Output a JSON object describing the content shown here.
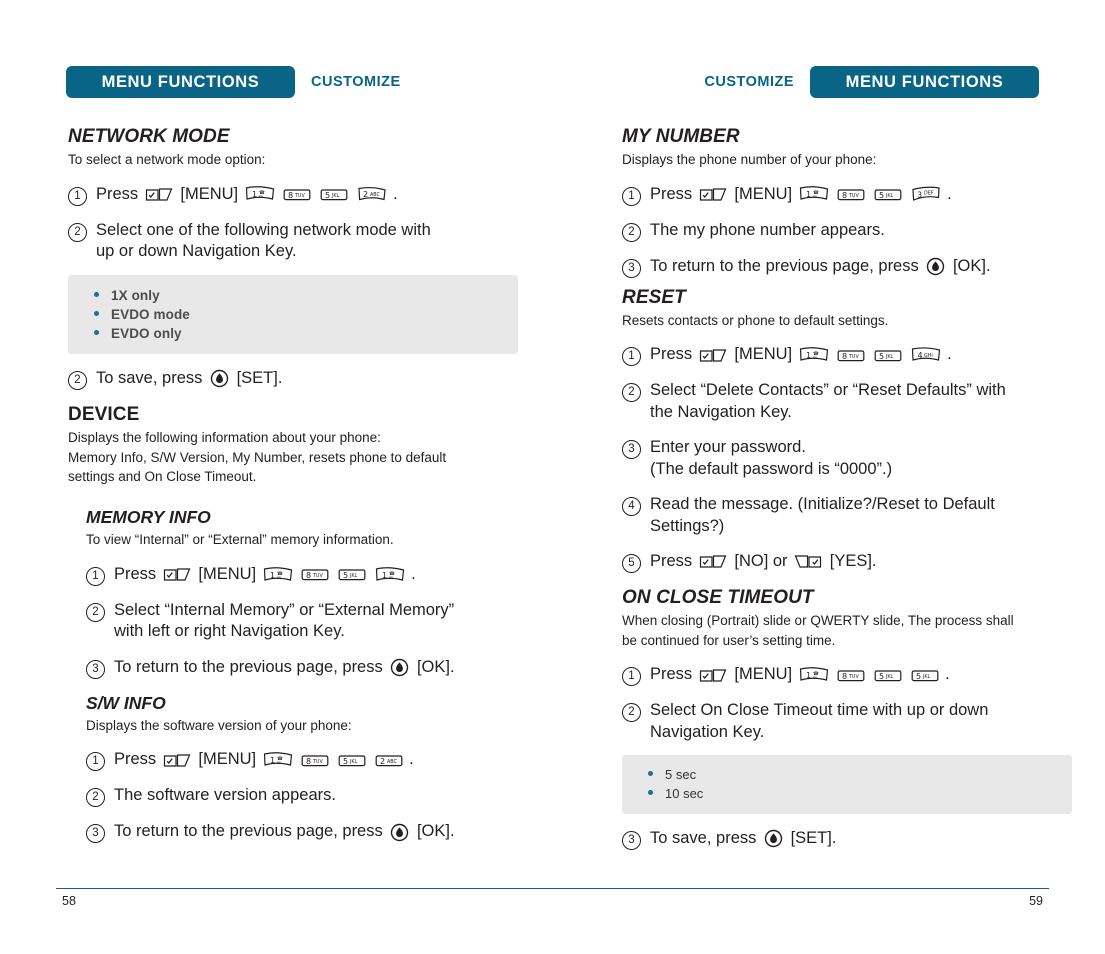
{
  "header": {
    "left": {
      "chip": "MENU FUNCTIONS",
      "word": "CUSTOMIZE"
    },
    "right": {
      "word": "CUSTOMIZE",
      "chip": "MENU FUNCTIONS"
    },
    "accent_color": "#0a6486"
  },
  "footer": {
    "left_page": "58",
    "right_page": "59",
    "rule_color": "#18607f"
  },
  "left_column": {
    "network_mode": {
      "heading": "NETWORK MODE",
      "intro": "To select a network mode option:",
      "step1": {
        "num": "1",
        "press": "Press",
        "menu": "[MENU]",
        "keys": [
          "1",
          "8",
          "5",
          "2"
        ],
        "keysub": [
          "",
          "TUV",
          "JKL",
          "ABC"
        ],
        "period": "."
      },
      "step2": {
        "num": "2",
        "line1": "Select one of the following network mode with",
        "line2": "up or down Navigation Key."
      },
      "options": [
        "1X only",
        "EVDO mode",
        "EVDO only"
      ],
      "step3": {
        "num": "2",
        "pre": "To save, press",
        "post": "[SET]."
      }
    },
    "device": {
      "heading": "DEVICE",
      "intro_line1": "Displays the following information about your phone:",
      "intro_line2": "Memory Info, S/W Version, My Number, resets phone to default",
      "intro_line3": "settings and On Close Timeout."
    },
    "memory_info": {
      "heading": "MEMORY INFO",
      "intro": "To view “Internal” or “External” memory information.",
      "step1": {
        "num": "1",
        "press": "Press",
        "menu": "[MENU]",
        "keys": [
          "1",
          "8",
          "5",
          "1"
        ],
        "keysub": [
          "",
          "TUV",
          "JKL",
          ""
        ],
        "period": "."
      },
      "step2": {
        "num": "2",
        "line1": "Select “Internal Memory” or “External Memory”",
        "line2": "with left or right Navigation Key."
      },
      "step3": {
        "num": "3",
        "pre": "To return to the previous page, press",
        "post": "[OK]."
      }
    },
    "sw_info": {
      "heading": "S/W INFO",
      "intro": "Displays the software version of your phone:",
      "step1": {
        "num": "1",
        "press": "Press",
        "menu": "[MENU]",
        "keys": [
          "1",
          "8",
          "5",
          "2"
        ],
        "keysub": [
          "",
          "TUV",
          "JKL",
          "ABC"
        ],
        "period": "."
      },
      "step2": {
        "num": "2",
        "text": "The software version appears."
      },
      "step3": {
        "num": "3",
        "pre": "To return to the previous page, press",
        "post": "[OK]."
      }
    }
  },
  "right_column": {
    "my_number": {
      "heading": "MY NUMBER",
      "intro": "Displays the phone number of your phone:",
      "step1": {
        "num": "1",
        "press": "Press",
        "menu": "[MENU]",
        "keys": [
          "1",
          "8",
          "5",
          "3"
        ],
        "keysub": [
          "",
          "TUV",
          "JKL",
          "DEF"
        ],
        "period": "."
      },
      "step2": {
        "num": "2",
        "text": "The my phone number appears."
      },
      "step3": {
        "num": "3",
        "pre": "To return to the previous page, press",
        "post": "[OK]."
      }
    },
    "reset": {
      "heading": "RESET",
      "intro": "Resets contacts or phone to default settings.",
      "step1": {
        "num": "1",
        "press": "Press",
        "menu": "[MENU]",
        "keys": [
          "1",
          "8",
          "5",
          "4"
        ],
        "keysub": [
          "",
          "TUV",
          "JKL",
          "GHI"
        ],
        "period": "."
      },
      "step2": {
        "num": "2",
        "line1": "Select “Delete Contacts” or “Reset Defaults” with",
        "line2": "the Navigation Key."
      },
      "step3": {
        "num": "3",
        "line1": "Enter your password.",
        "line2": "(The default password is “0000”.)"
      },
      "step4": {
        "num": "4",
        "line1": "Read the message. (Initialize?/Reset to Default",
        "line2": "Settings?)"
      },
      "step5": {
        "num": "5",
        "press": "Press",
        "no": "[NO] or",
        "yes": "[YES]."
      }
    },
    "on_close_timeout": {
      "heading": "ON CLOSE TIMEOUT",
      "intro_line1": "When closing (Portrait) slide or QWERTY slide, The process shall",
      "intro_line2": "be continued for user’s setting time.",
      "step1": {
        "num": "1",
        "press": "Press",
        "menu": "[MENU]",
        "keys": [
          "1",
          "8",
          "5",
          "5"
        ],
        "keysub": [
          "",
          "TUV",
          "JKL",
          "JKL"
        ],
        "period": "."
      },
      "step2": {
        "num": "2",
        "line1": "Select On Close Timeout time with up or down",
        "line2": "Navigation Key."
      },
      "options": [
        "5 sec",
        "10 sec"
      ],
      "step3": {
        "num": "3",
        "pre": "To save, press",
        "post": "[SET]."
      }
    }
  },
  "icons": {
    "left_soft_key": "left-soft-key-icon",
    "right_soft_key": "right-soft-key-icon",
    "ok_key": "ok-center-key-icon",
    "number_key": "number-key-icon",
    "bullet": "bullet-dot-icon"
  }
}
